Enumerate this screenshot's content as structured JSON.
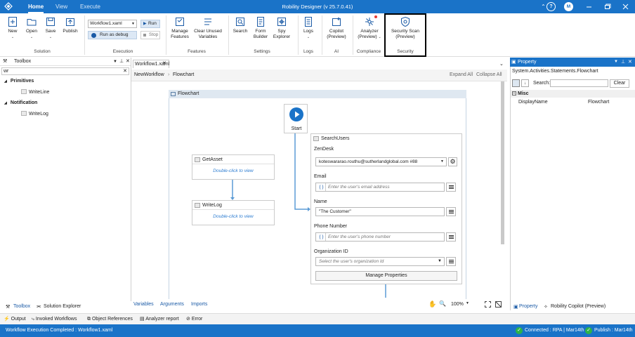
{
  "titlebar": {
    "tabs": [
      "Home",
      "View",
      "Execute"
    ],
    "app_title": "Robility Designer (v 25.7.0.41)",
    "user_initial": "M",
    "help_icon": "?"
  },
  "ribbon": {
    "new": "New",
    "open": "Open",
    "save": "Save",
    "publish": "Publish",
    "solution_group": "Solution",
    "workflow_select": "Workflow1.xaml",
    "run": "Run",
    "run_debug": "Run as debug",
    "stop": "Stop",
    "execution_group": "Execution",
    "manage_features": [
      "Manage",
      "Features"
    ],
    "clear_unused": [
      "Clear Unused",
      "Variables"
    ],
    "features_group": "Features",
    "search": "Search",
    "form_builder": [
      "Form",
      "Builder"
    ],
    "spy_explorer": [
      "Spy",
      "Explorer"
    ],
    "settings_group": "Settings",
    "logs": "Logs",
    "logs_group": "Logs",
    "copilot": [
      "Copilot",
      "(Preview)"
    ],
    "ai_group": "AI",
    "analyzer": [
      "Analyzer",
      "(Preview)"
    ],
    "compliance_group": "Compliance",
    "security_scan": [
      "Security Scan",
      "(Preview)"
    ],
    "security_group": "Security"
  },
  "toolbox": {
    "title": "Toolbox",
    "search_value": "wr",
    "categories": [
      {
        "name": "Primitives",
        "items": [
          "WriteLine"
        ]
      },
      {
        "name": "Notification",
        "items": [
          "WriteLog"
        ]
      }
    ]
  },
  "designer": {
    "doc_tab": "Workflow1.xaml",
    "breadcrumb": [
      "NewWorkflow",
      "Flowchart"
    ],
    "expand_all": "Expand All",
    "collapse_all": "Collapse All",
    "flowchart_title": "Flowchart",
    "start_label": "Start",
    "get_asset": {
      "title": "GetAsset",
      "hint": "Double-click to view"
    },
    "write_log": {
      "title": "WriteLog",
      "hint": "Double-click to view"
    },
    "search_users": {
      "title": "SearchUsers",
      "zendesk_label": "ZenDesk",
      "zendesk_value": "koteswararao.routhu@sutherlandglobal.com #88",
      "email_label": "Email",
      "email_placeholder": "Enter the user's email address",
      "name_label": "Name",
      "name_value": "\"The Customer\"",
      "phone_label": "Phone Number",
      "phone_placeholder": "Enter the user's phone number",
      "org_label": "Organization ID",
      "org_placeholder": "Select the user's organization Id",
      "manage_btn": "Manage Properties",
      "brace": "{ }"
    },
    "footer": {
      "tabs": [
        "Variables",
        "Arguments",
        "Imports"
      ],
      "zoom": "100%"
    }
  },
  "property": {
    "title": "Property",
    "type_name": "System.Activities.Statements.Flowchart",
    "search_label": "Search:",
    "clear": "Clear",
    "category": "Misc",
    "rows": [
      {
        "name": "DisplayName",
        "value": "Flowchart"
      }
    ]
  },
  "bottom": {
    "left_tabs": [
      "Toolbox",
      "Solution Explorer"
    ],
    "right_tabs": [
      "Property",
      "Robility Copilot (Preview)"
    ],
    "output_tabs": [
      "Output",
      "Invoked Workflows",
      "Object References",
      "Analyzer report",
      "Error"
    ]
  },
  "status": {
    "message": "Workflow Execution Completed : Workflow1.xaml",
    "connected": "Connected : RPA | Mar14th",
    "publish": "Publish : Mar14th"
  },
  "colors": {
    "accent": "#1a73c8",
    "success": "#2db34a",
    "connector": "#5b9bd5"
  }
}
